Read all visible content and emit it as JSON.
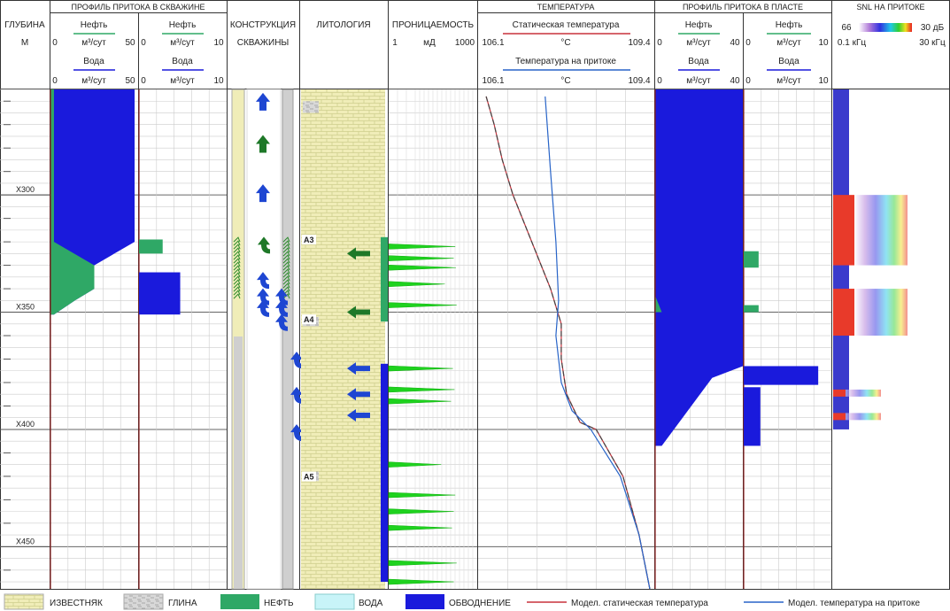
{
  "tracks": {
    "depth": {
      "title": "ГЛУБИНА",
      "unit": "М"
    },
    "well_profile": {
      "title": "ПРОФИЛЬ ПРИТОКА В СКВАЖИНЕ",
      "left": {
        "oil_label": "Нефть",
        "oil_unit": "м³/сут",
        "oil_min": "0",
        "oil_max": "50",
        "water_label": "Вода",
        "water_unit": "м³/сут",
        "water_min": "0",
        "water_max": "50"
      },
      "right": {
        "oil_label": "Нефть",
        "oil_unit": "м³/сут",
        "oil_min": "0",
        "oil_max": "10",
        "water_label": "Вода",
        "water_unit": "м³/сут",
        "water_min": "0",
        "water_max": "10"
      }
    },
    "construction": {
      "title_1": "КОНСТРУКЦИЯ",
      "title_2": "СКВАЖИНЫ"
    },
    "lithology": {
      "title": "ЛИТОЛОГИЯ",
      "layers": [
        "А3",
        "А4",
        "А5"
      ]
    },
    "permeability": {
      "title": "ПРОНИЦАЕМОСТЬ",
      "min": "1",
      "unit": "мД",
      "max": "1000"
    },
    "temperature": {
      "title": "ТЕМПЕРАТУРА",
      "static_label": "Статическая температура",
      "inflow_label": "Температура на притоке",
      "min": "106.1",
      "unit": "°С",
      "max": "109.4"
    },
    "reservoir_profile": {
      "title": "ПРОФИЛЬ ПРИТОКА В ПЛАСТЕ",
      "left": {
        "oil_label": "Нефть",
        "oil_unit": "м³/сут",
        "oil_min": "0",
        "oil_max": "40",
        "water_label": "Вода",
        "water_unit": "м³/сут",
        "water_min": "0",
        "water_max": "40"
      },
      "right": {
        "oil_label": "Нефть",
        "oil_unit": "м³/сут",
        "oil_min": "0",
        "oil_max": "10",
        "water_label": "Вода",
        "water_unit": "м³/сут",
        "water_min": "0",
        "water_max": "10"
      }
    },
    "snl": {
      "title": "SNL НА ПРИТОКЕ",
      "db_min": "66",
      "db_max": "30 дБ",
      "f_min": "0.1 кГц",
      "f_max": "30 кГц"
    }
  },
  "legend": {
    "limestone": "ИЗВЕСТНЯК",
    "clay": "ГЛИНА",
    "oil": "НЕФТЬ",
    "water": "ВОДА",
    "watering": "ОБВОДНЕНИЕ",
    "static_model": "Модел. статическая температура",
    "inflow_model": "Модел. температура на притоке"
  },
  "colors": {
    "oil": "#2fa866",
    "water": "#1a1adc",
    "limestone": "#f0edb8",
    "clay": "#d4d4d4",
    "perm": "#1ed21e",
    "static": "#c8323c",
    "inflow": "#2864c8",
    "arrow_blue": "#1e46d2",
    "arrow_green": "#1e7828"
  },
  "chart_data": {
    "type": "well-log",
    "depth_ticks": [
      "X300",
      "X350",
      "X400",
      "X450"
    ],
    "depth_range": [
      255,
      468
    ],
    "well_cum_left": {
      "oil": [
        [
          255,
          2
        ],
        [
          320,
          2
        ],
        [
          330,
          25
        ],
        [
          340,
          25
        ],
        [
          345,
          14
        ],
        [
          351,
          2
        ]
      ],
      "water": [
        [
          255,
          48
        ],
        [
          320,
          48
        ],
        [
          330,
          25
        ],
        [
          340,
          25
        ],
        [
          345,
          14
        ],
        [
          351,
          2
        ]
      ]
    },
    "well_bars_right": {
      "oil": [
        [
          319,
          325,
          2.7
        ]
      ],
      "water": [
        [
          333,
          351,
          4.7
        ]
      ]
    },
    "reservoir_cum_left": {
      "oil": [
        [
          255,
          0
        ],
        [
          320,
          0
        ],
        [
          343,
          0
        ],
        [
          350,
          3
        ]
      ],
      "water": [
        [
          255,
          40
        ],
        [
          320,
          40
        ],
        [
          343,
          40
        ],
        [
          373,
          40
        ],
        [
          378,
          26
        ],
        [
          407,
          3
        ]
      ]
    },
    "reservoir_bars_right": {
      "oil": [
        [
          324,
          331,
          1.7
        ],
        [
          347,
          350,
          1.7
        ]
      ],
      "water": [
        [
          373,
          381,
          8.5
        ],
        [
          382,
          407,
          1.9
        ]
      ]
    },
    "permeability_peaks": [
      [
        322,
        180
      ],
      [
        327,
        160
      ],
      [
        331,
        190
      ],
      [
        338,
        80
      ],
      [
        347,
        200
      ],
      [
        374,
        150
      ],
      [
        383,
        170
      ],
      [
        388,
        130
      ],
      [
        415,
        60
      ],
      [
        428,
        180
      ],
      [
        435,
        160
      ],
      [
        442,
        140
      ],
      [
        457,
        200
      ],
      [
        465,
        160
      ]
    ],
    "temperature_static": [
      [
        258,
        106.25
      ],
      [
        270,
        106.4
      ],
      [
        285,
        106.55
      ],
      [
        300,
        106.75
      ],
      [
        320,
        107.1
      ],
      [
        340,
        107.45
      ],
      [
        355,
        107.65
      ],
      [
        370,
        107.65
      ],
      [
        385,
        107.75
      ],
      [
        397,
        108.0
      ],
      [
        400,
        108.3
      ],
      [
        420,
        108.8
      ],
      [
        445,
        109.1
      ],
      [
        468,
        109.3
      ]
    ],
    "temperature_inflow": [
      [
        258,
        107.35
      ],
      [
        290,
        107.45
      ],
      [
        320,
        107.55
      ],
      [
        345,
        107.6
      ],
      [
        360,
        107.55
      ],
      [
        380,
        107.65
      ],
      [
        392,
        107.85
      ],
      [
        400,
        108.2
      ],
      [
        420,
        108.75
      ],
      [
        445,
        109.1
      ],
      [
        468,
        109.3
      ]
    ],
    "snl_bands": [
      [
        300,
        330
      ],
      [
        340,
        360
      ],
      [
        383,
        386
      ],
      [
        393,
        396
      ]
    ]
  }
}
